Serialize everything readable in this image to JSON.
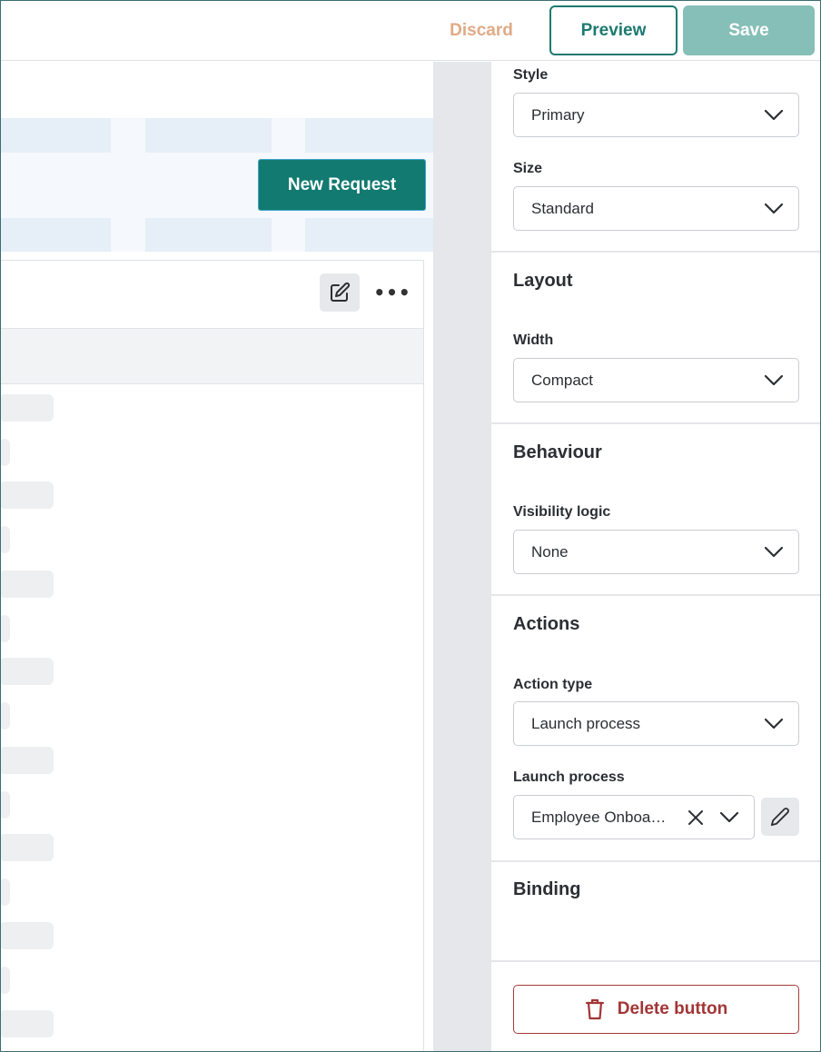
{
  "topbar": {
    "discard_label": "Discard",
    "preview_label": "Preview",
    "save_label": "Save"
  },
  "canvas": {
    "new_request_label": "New Request"
  },
  "panel": {
    "style": {
      "label": "Style",
      "value": "Primary"
    },
    "size": {
      "label": "Size",
      "value": "Standard"
    },
    "layout": {
      "title": "Layout",
      "width": {
        "label": "Width",
        "value": "Compact"
      }
    },
    "behaviour": {
      "title": "Behaviour",
      "visibility": {
        "label": "Visibility logic",
        "value": "None"
      }
    },
    "actions": {
      "title": "Actions",
      "action_type": {
        "label": "Action type",
        "value": "Launch process"
      },
      "launch_process": {
        "label": "Launch process",
        "value": "Employee Onboa…"
      }
    },
    "binding": {
      "title": "Binding"
    },
    "delete_label": "Delete button"
  },
  "colors": {
    "accent": "#127a70",
    "save_disabled": "#86bfb7",
    "discard": "#e0aa86",
    "danger": "#a33535"
  }
}
